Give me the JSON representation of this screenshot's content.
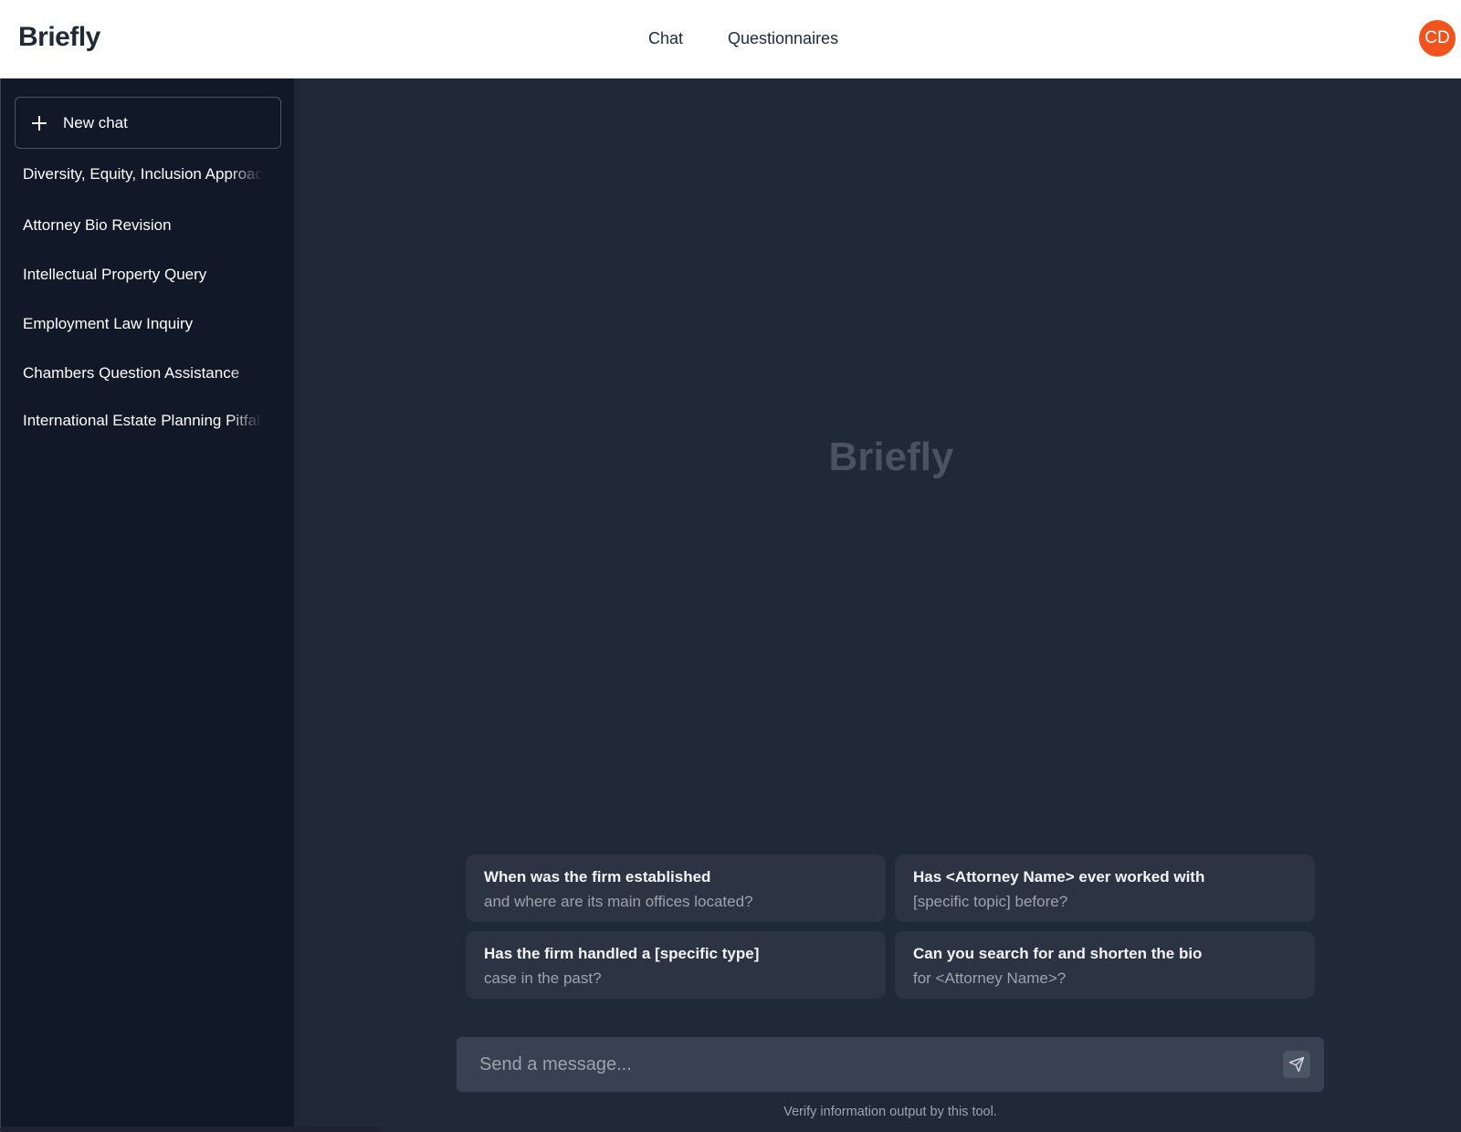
{
  "header": {
    "logo": "Briefly",
    "nav": [
      {
        "label": "Chat"
      },
      {
        "label": "Questionnaires"
      }
    ],
    "avatar_initials": "CD",
    "avatar_color": "#f2521b"
  },
  "sidebar": {
    "new_chat_label": "New chat",
    "history": [
      {
        "label": "Diversity, Equity, Inclusion Approach"
      },
      {
        "label": "Attorney Bio Revision"
      },
      {
        "label": "Intellectual Property Query"
      },
      {
        "label": "Employment Law Inquiry"
      },
      {
        "label": "Chambers Question Assistance"
      },
      {
        "label": "International Estate Planning Pitfalls"
      }
    ]
  },
  "main": {
    "watermark": "Briefly",
    "suggestions": [
      {
        "title": "When was the firm established",
        "subtitle": "and where are its main offices located?"
      },
      {
        "title": "Has <Attorney Name> ever worked with",
        "subtitle": "[specific topic] before?"
      },
      {
        "title": "Has the firm handled a [specific type]",
        "subtitle": "case in the past?"
      },
      {
        "title": "Can you search for and shorten the bio",
        "subtitle": "for <Attorney Name>?"
      }
    ],
    "input": {
      "placeholder": "Send a message...",
      "value": ""
    },
    "send_icon": "send-icon",
    "disclaimer": "Verify information output by this tool."
  }
}
